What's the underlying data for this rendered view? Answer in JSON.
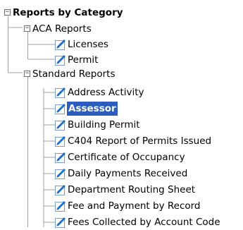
{
  "tree": {
    "root": {
      "label": "Reports by Category",
      "toggle": "−",
      "expanded": true
    },
    "categories": [
      {
        "label": "ACA Reports",
        "toggle": "−",
        "expanded": true,
        "items": [
          {
            "label": "Licenses",
            "icon": "report-icon",
            "selected": false
          },
          {
            "label": "Permit",
            "icon": "report-icon",
            "selected": false
          }
        ]
      },
      {
        "label": "Standard Reports",
        "toggle": "−",
        "expanded": true,
        "items": [
          {
            "label": "Address Activity",
            "icon": "report-icon",
            "selected": false
          },
          {
            "label": "Assessor",
            "icon": "report-icon",
            "selected": true
          },
          {
            "label": "Building Permit",
            "icon": "report-icon",
            "selected": false
          },
          {
            "label": "C404 Report of Permits Issued",
            "icon": "report-icon",
            "selected": false
          },
          {
            "label": "Certificate of Occupancy",
            "icon": "report-icon",
            "selected": false
          },
          {
            "label": "Daily Payments Received",
            "icon": "report-icon",
            "selected": false
          },
          {
            "label": "Department Routing Sheet",
            "icon": "report-icon",
            "selected": false
          },
          {
            "label": "Fee and Payment by Record",
            "icon": "report-icon",
            "selected": false
          },
          {
            "label": "Fees Collected by Account Code",
            "icon": "report-icon",
            "selected": false
          }
        ]
      }
    ]
  },
  "colors": {
    "selected_background": "#2b5cbe",
    "selected_text": "#ffffff",
    "tree_line": "#a0a0a0",
    "icon_accent": "#1a6fd1"
  }
}
